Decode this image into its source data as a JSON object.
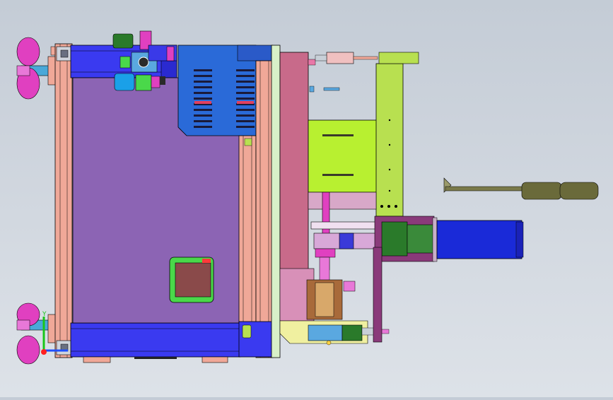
{
  "viewport": {
    "background_top": "#c4ccd6",
    "background_bottom": "#dde2e8"
  },
  "triad": {
    "y_label": "Y",
    "x_color": "#1f4fff",
    "y_color": "#19c619",
    "z_color": "#ff2020"
  },
  "colors": {
    "frame_salmon": "#f0a898",
    "frame_blue": "#3a3af0",
    "panel_purple": "#8c64b4",
    "cover_blue": "#2a6ad8",
    "plate_mauve": "#c86a8a",
    "bracket_lime": "#b8e050",
    "motor_blue": "#1a2ad8",
    "motor_green": "#2a7a2a",
    "foot_magenta": "#e040c0",
    "handle_olive": "#6a6a3a",
    "window_brown": "#8a4a4a",
    "window_green": "#4ad84a"
  },
  "icons": {
    "viewport": "cad-3d-assembly",
    "triad": "coordinate-triad-icon"
  }
}
